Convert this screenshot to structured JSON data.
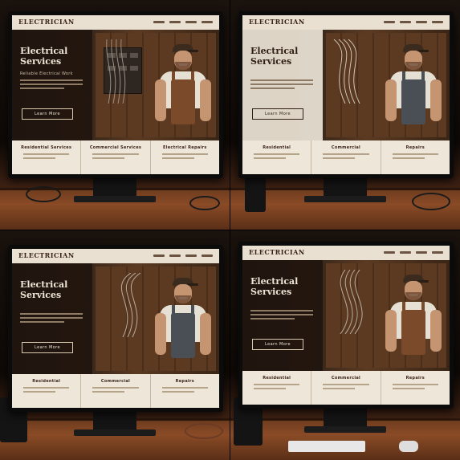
{
  "image": {
    "layout": "2x2 grid of photo mockups",
    "subject": "website hero section on desktop monitors, smiling electrician in overalls, wooden desk",
    "colors": {
      "background": "#120c08",
      "desk_wood": "#8a4b26",
      "screen_cream": "#eee6d8",
      "hero_dark": "#2a1b12",
      "text_light": "#efe6d6",
      "overalls": "#7a4a2a"
    }
  },
  "panels": [
    {
      "logo": "ELECTRICIAN",
      "headline": "Electrical Services",
      "subline": "Reliable Electrical Work",
      "button": "Learn More",
      "cards": [
        "Residential Services",
        "Commercial Services",
        "Electrical Repairs"
      ]
    },
    {
      "logo": "ELECTRICIAN",
      "headline": "Electrical Services",
      "subline": "",
      "button": "Learn More",
      "cards": [
        "Residential",
        "Commercial",
        "Repairs"
      ]
    },
    {
      "logo": "ELECTRICIAN",
      "headline": "Electrical Services",
      "subline": "",
      "button": "Learn More",
      "cards": [
        "Residential",
        "Commercial",
        "Repairs"
      ]
    },
    {
      "logo": "ELECTRICIAN",
      "headline": "Electrical Services",
      "subline": "",
      "button": "Learn More",
      "cards": [
        "Residential",
        "Commercial",
        "Repairs"
      ]
    }
  ]
}
